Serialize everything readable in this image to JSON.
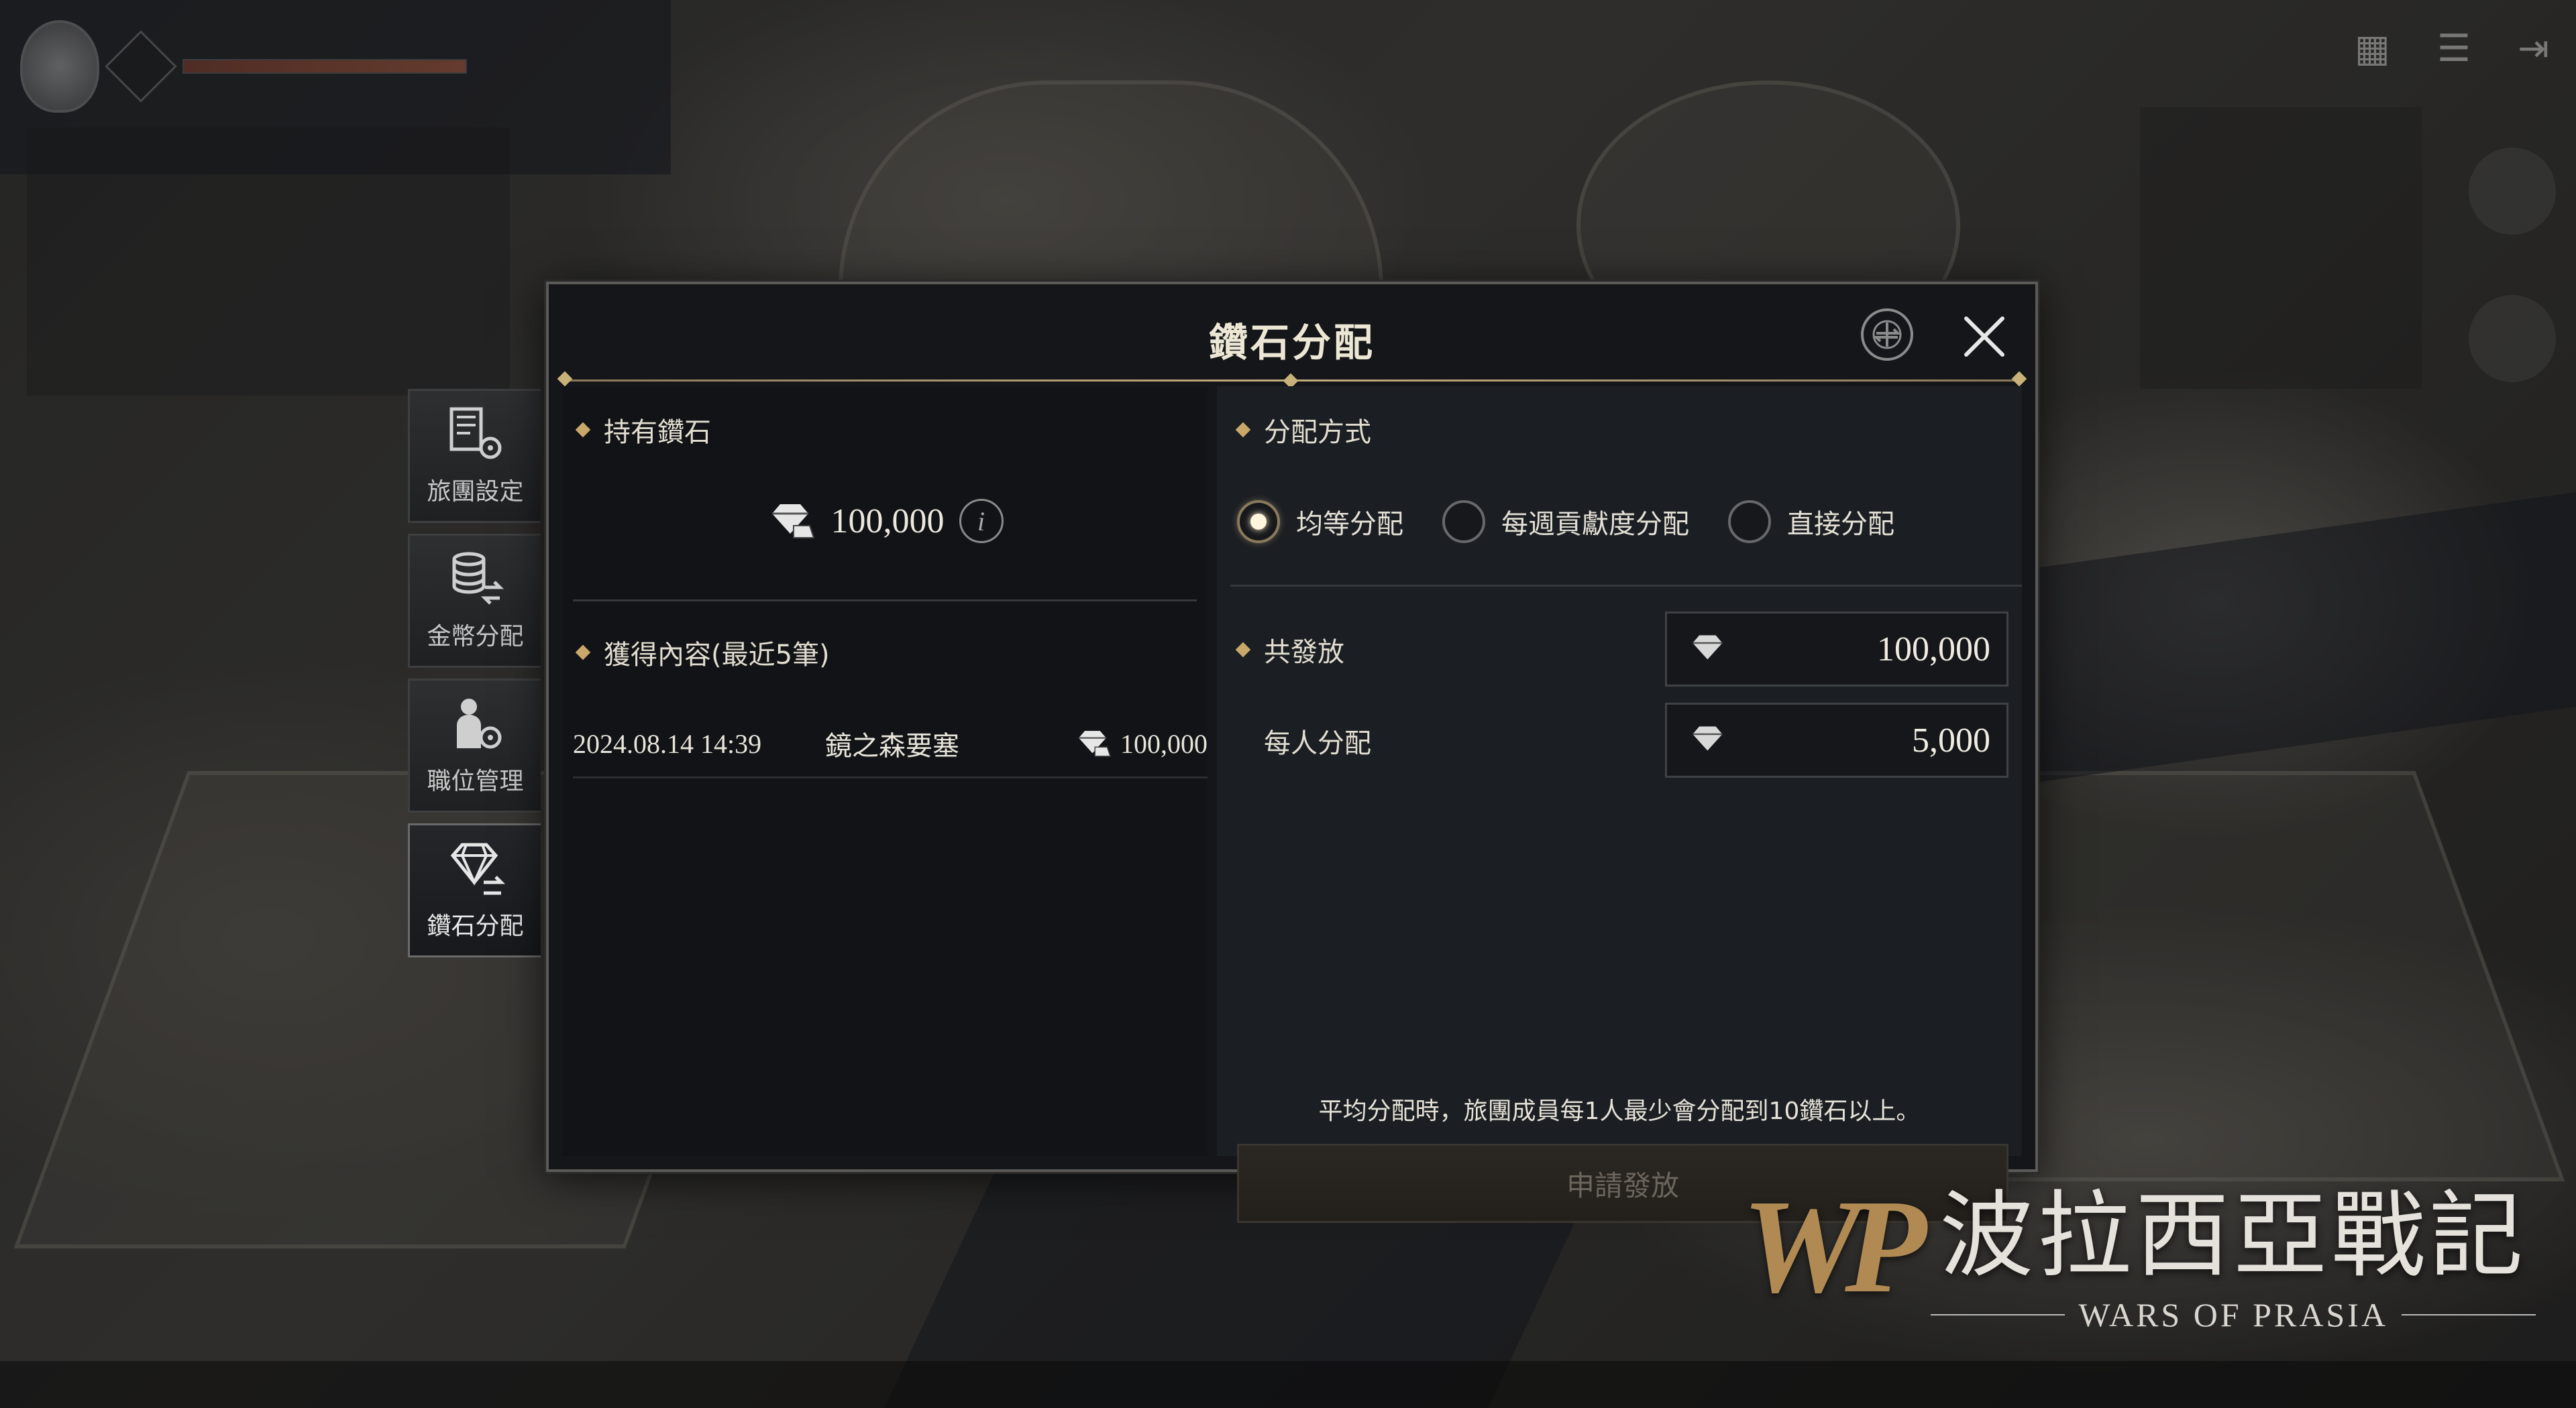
{
  "dialog": {
    "title": "鑽石分配",
    "holding": {
      "heading": "持有鑽石",
      "amount": "100,000",
      "info_glyph": "i"
    },
    "recent": {
      "heading": "獲得內容(最近5筆)",
      "rows": [
        {
          "datetime": "2024.08.14 14:39",
          "place": "鏡之森要塞",
          "amount": "100,000"
        }
      ]
    },
    "method": {
      "heading": "分配方式",
      "options": [
        {
          "label": "均等分配",
          "selected": true
        },
        {
          "label": "每週貢獻度分配",
          "selected": false
        },
        {
          "label": "直接分配",
          "selected": false
        }
      ]
    },
    "total": {
      "label": "共發放",
      "value": "100,000"
    },
    "per_person": {
      "label": "每人分配",
      "value": "5,000"
    },
    "note": "平均分配時，旅團成員每1人最少會分配到10鑽石以上。",
    "submit_label": "申請發放"
  },
  "side_menu": [
    {
      "label": "旅團設定",
      "icon": "guild-settings-icon",
      "active": false
    },
    {
      "label": "金幣分配",
      "icon": "gold-distribution-icon",
      "active": false
    },
    {
      "label": "職位管理",
      "icon": "rank-management-icon",
      "active": false
    },
    {
      "label": "鑽石分配",
      "icon": "diamond-distribution-icon",
      "active": true
    }
  ],
  "logo": {
    "mark": "WP",
    "title_cn": "波拉西亞戰記",
    "title_en": "WARS OF PRASIA"
  },
  "colors": {
    "accent_gold": "#c9a869",
    "dialog_bg": "#141619",
    "text_primary": "#ece6d4"
  }
}
